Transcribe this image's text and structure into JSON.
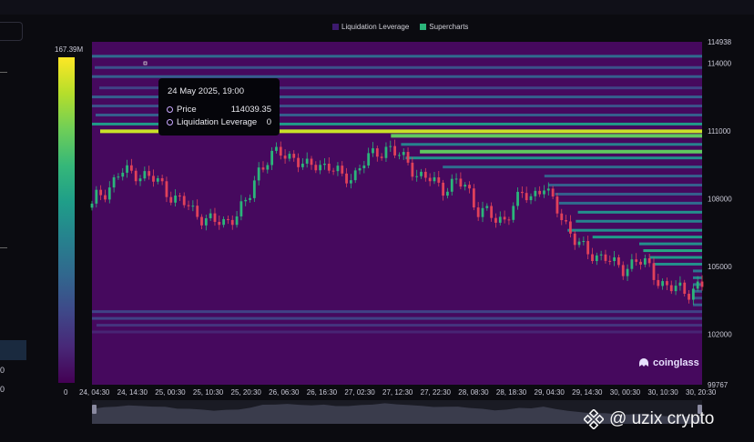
{
  "legend": [
    {
      "label": "Liquidation Leverage",
      "color": "#3d1a6e"
    },
    {
      "label": "Supercharts",
      "color": "#2bb57a"
    }
  ],
  "colorbar": {
    "max_label": "167.39M",
    "min_label": "0",
    "stops": [
      "#fde725",
      "#b5de2b",
      "#6ece58",
      "#35b779",
      "#1f9e89",
      "#26828e",
      "#31688e",
      "#3e4989",
      "#482878",
      "#440154"
    ]
  },
  "tooltip": {
    "date": "24 May 2025, 19:00",
    "rows": [
      {
        "label": "Price",
        "value": "114039.35"
      },
      {
        "label": "Liquidation Leverage",
        "value": "0"
      }
    ]
  },
  "left_panel": {
    "values": [
      "0",
      "0"
    ]
  },
  "brand": "coinglass",
  "watermark": "@ uzix crypto",
  "chart_data": {
    "type": "heatmap",
    "x_ticks": [
      "24, 04:30",
      "24, 14:30",
      "25, 00:30",
      "25, 10:30",
      "25, 20:30",
      "26, 06:30",
      "26, 16:30",
      "27, 02:30",
      "27, 12:30",
      "27, 22:30",
      "28, 08:30",
      "28, 18:30",
      "29, 04:30",
      "29, 14:30",
      "30, 00:30",
      "30, 10:30",
      "30, 20:30"
    ],
    "y_ticks": [
      114938,
      114000,
      111000,
      108000,
      105000,
      102000,
      99767
    ],
    "ylim": [
      99767,
      114938
    ],
    "price_path": [
      [
        0,
        107600
      ],
      [
        2,
        108200
      ],
      [
        5,
        108400
      ],
      [
        9,
        109100
      ],
      [
        14,
        109200
      ],
      [
        19,
        108900
      ],
      [
        23,
        108600
      ],
      [
        27,
        108000
      ],
      [
        31,
        107700
      ],
      [
        35,
        107300
      ],
      [
        40,
        106900
      ],
      [
        44,
        107000
      ],
      [
        48,
        107400
      ],
      [
        51,
        107800
      ],
      [
        54,
        109200
      ],
      [
        58,
        109800
      ],
      [
        62,
        110000
      ],
      [
        66,
        109900
      ],
      [
        70,
        109300
      ],
      [
        74,
        109600
      ],
      [
        78,
        109400
      ],
      [
        82,
        108900
      ],
      [
        86,
        109100
      ],
      [
        90,
        109700
      ],
      [
        94,
        110100
      ],
      [
        97,
        110300
      ],
      [
        100,
        109900
      ],
      [
        104,
        109600
      ],
      [
        107,
        109000
      ],
      [
        111,
        108800
      ],
      [
        115,
        108500
      ],
      [
        119,
        108700
      ],
      [
        123,
        108500
      ],
      [
        126,
        107600
      ],
      [
        129,
        107400
      ],
      [
        132,
        107000
      ],
      [
        135,
        107100
      ],
      [
        138,
        107700
      ],
      [
        141,
        108100
      ],
      [
        144,
        108100
      ],
      [
        146,
        108400
      ],
      [
        148,
        108600
      ],
      [
        150,
        108000
      ],
      [
        153,
        107400
      ],
      [
        156,
        106800
      ],
      [
        159,
        106000
      ],
      [
        162,
        105600
      ],
      [
        165,
        105500
      ],
      [
        168,
        105500
      ],
      [
        171,
        105000
      ],
      [
        174,
        104900
      ],
      [
        178,
        105300
      ],
      [
        182,
        105000
      ],
      [
        186,
        104400
      ],
      [
        189,
        104000
      ],
      [
        192,
        104000
      ],
      [
        195,
        103900
      ],
      [
        198,
        104100
      ]
    ],
    "bands": [
      {
        "y": 114300,
        "i": 0.35
      },
      {
        "y": 113800,
        "i": 0.25
      },
      {
        "y": 113400,
        "i": 0.3
      },
      {
        "y": 112900,
        "i": 0.2
      },
      {
        "y": 112500,
        "i": 0.3
      },
      {
        "y": 112100,
        "i": 0.25
      },
      {
        "y": 111700,
        "i": 0.3
      },
      {
        "y": 111300,
        "i": 0.55
      },
      {
        "y": 111000,
        "i": 0.92
      },
      {
        "y": 110800,
        "i": 0.75
      },
      {
        "y": 110400,
        "i": 0.45
      },
      {
        "y": 110100,
        "i": 0.75
      },
      {
        "y": 109800,
        "i": 0.5
      },
      {
        "y": 109400,
        "i": 0.35
      },
      {
        "y": 109000,
        "i": 0.3
      },
      {
        "y": 108600,
        "i": 0.3
      },
      {
        "y": 108200,
        "i": 0.3
      },
      {
        "y": 107800,
        "i": 0.35
      },
      {
        "y": 107400,
        "i": 0.5
      },
      {
        "y": 107000,
        "i": 0.45
      },
      {
        "y": 106600,
        "i": 0.5
      },
      {
        "y": 106300,
        "i": 0.55
      },
      {
        "y": 106000,
        "i": 0.5
      },
      {
        "y": 105700,
        "i": 0.6
      },
      {
        "y": 105400,
        "i": 0.55
      },
      {
        "y": 105100,
        "i": 0.5
      },
      {
        "y": 104800,
        "i": 0.4
      },
      {
        "y": 104500,
        "i": 0.45
      },
      {
        "y": 104200,
        "i": 0.35
      },
      {
        "y": 103900,
        "i": 0.3
      },
      {
        "y": 103600,
        "i": 0.25
      },
      {
        "y": 103300,
        "i": 0.3
      },
      {
        "y": 103000,
        "i": 0.2
      },
      {
        "y": 102700,
        "i": 0.2
      },
      {
        "y": 102400,
        "i": 0.15
      },
      {
        "y": 102100,
        "i": 0.1
      }
    ]
  }
}
